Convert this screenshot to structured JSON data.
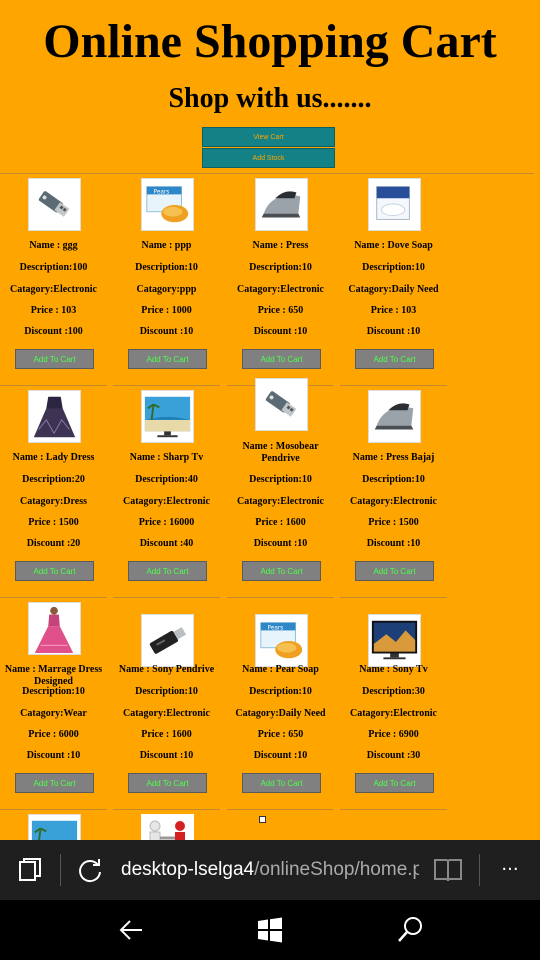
{
  "header": {
    "title": "Online Shopping Cart",
    "subtitle": "Shop with us.......",
    "view_cart_label": "View Cart",
    "add_stock_label": "Add Stock"
  },
  "product_labels": {
    "add_to_cart": "Add To Cart"
  },
  "products": [
    [
      {
        "name": "Name : ggg",
        "description": "Description:100",
        "category": "Catagory:Electronic",
        "price": "Price : 103",
        "discount": "Discount :100",
        "icon": "usb-drive-icon"
      },
      {
        "name": "Name : ppp",
        "description": "Description:10",
        "category": "Catagory:ppp",
        "price": "Price : 1000",
        "discount": "Discount :10",
        "icon": "soap-box-icon"
      },
      {
        "name": "Name : Press",
        "description": "Description:10",
        "category": "Catagory:Electronic",
        "price": "Price : 650",
        "discount": "Discount :10",
        "icon": "iron-icon"
      },
      {
        "name": "Name : Dove Soap",
        "description": "Description:10",
        "category": "Catagory:Daily Need",
        "price": "Price : 103",
        "discount": "Discount :10",
        "icon": "dove-soap-icon"
      }
    ],
    [
      {
        "name": "Name : Lady Dress",
        "description": "Description:20",
        "category": "Catagory:Dress",
        "price": "Price : 1500",
        "discount": "Discount :20",
        "icon": "dress-icon"
      },
      {
        "name": "Name : Sharp Tv",
        "description": "Description:40",
        "category": "Catagory:Electronic",
        "price": "Price : 16000",
        "discount": "Discount :40",
        "icon": "beach-tv-icon"
      },
      {
        "name": "Name : Mosobear Pendrive",
        "description": "Description:10",
        "category": "Catagory:Electronic",
        "price": "Price : 1600",
        "discount": "Discount :10",
        "icon": "usb-drive-icon"
      },
      {
        "name": "Name : Press Bajaj",
        "description": "Description:10",
        "category": "Catagory:Electronic",
        "price": "Price : 1500",
        "discount": "Discount :10",
        "icon": "iron-icon"
      }
    ],
    [
      {
        "name": "Name : Marrage Dress Designed",
        "description": "Description:10",
        "category": "Catagory:Wear",
        "price": "Price : 6000",
        "discount": "Discount :10",
        "icon": "gown-icon"
      },
      {
        "name": "Name : Sony Pendrive",
        "description": "Description:10",
        "category": "Catagory:Electronic",
        "price": "Price : 1600",
        "discount": "Discount :10",
        "icon": "pendrive-icon"
      },
      {
        "name": "Name : Pear Soap",
        "description": "Description:10",
        "category": "Catagory:Daily Need",
        "price": "Price : 650",
        "discount": "Discount :10",
        "icon": "soap-box-icon"
      },
      {
        "name": "Name : Sony Tv",
        "description": "Description:30",
        "category": "Catagory:Electronic",
        "price": "Price : 6900",
        "discount": "Discount :30",
        "icon": "tv-icon"
      }
    ]
  ],
  "partial_products": [
    {
      "icon": "beach-tv-icon"
    },
    {
      "icon": "handshake-icon"
    }
  ],
  "browser": {
    "url_host": "desktop-lselga4",
    "url_path": "/onlineShop/home.p"
  },
  "colors": {
    "page_background": "#ffa500",
    "top_button": "#138185",
    "add_button": "#808080",
    "add_button_text": "#4dff4d"
  }
}
